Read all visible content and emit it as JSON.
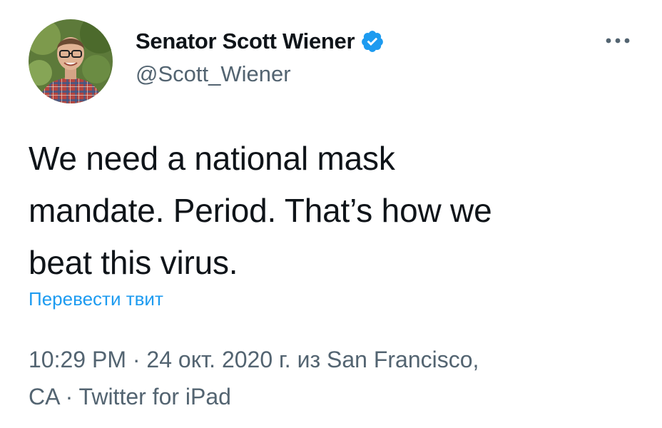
{
  "tweet": {
    "author": {
      "display_name": "Senator Scott Wiener",
      "handle": "@Scott_Wiener",
      "verified": true,
      "avatar": "profile-photo"
    },
    "more_icon": "ellipsis-icon",
    "text_lines": [
      "We need a national mask",
      "mandate. Period. That’s how we",
      "beat this virus."
    ],
    "translate_label": "Перевести твит",
    "meta": {
      "time": "10:29 PM",
      "separator": " · ",
      "date": "24 окт. 2020 г.",
      "from_word": " из ",
      "location_line1": "San Francisco,",
      "location_line2": "CA",
      "source": "Twitter for iPad"
    }
  },
  "colors": {
    "text_primary": "#0f1419",
    "text_secondary": "#536471",
    "accent": "#1d9bf0"
  }
}
